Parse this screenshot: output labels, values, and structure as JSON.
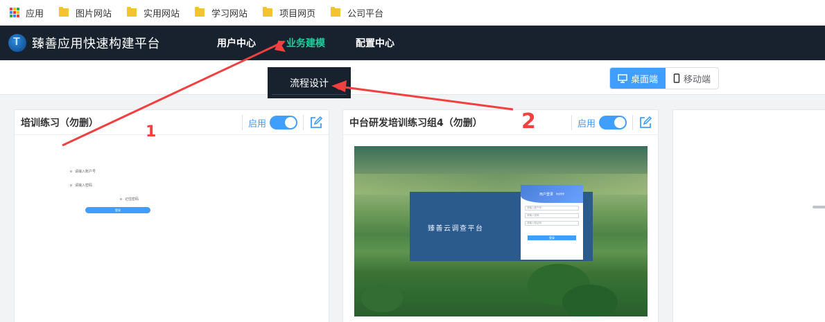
{
  "bookmarks": {
    "apps_label": "应用",
    "items": [
      "图片网站",
      "实用网站",
      "学习网站",
      "项目网页",
      "公司平台"
    ]
  },
  "nav": {
    "brand": "臻善应用快速构建平台",
    "items": [
      "用户中心",
      "业务建模",
      "配置中心"
    ],
    "active": "业务建模"
  },
  "dropdown": {
    "item": "流程设计"
  },
  "device_switch": {
    "desktop": "桌面端",
    "mobile": "移动端",
    "selected": "桌面端"
  },
  "cards": [
    {
      "title": "培训练习（勿删）",
      "enable_label": "启用",
      "enabled": true,
      "preview": {
        "field1": "请输入账户号",
        "field2": "请输入密码",
        "remember": "记住密码",
        "button": "登录"
      }
    },
    {
      "title": "中台研发培训练习组4（勿删）",
      "enable_label": "启用",
      "enabled": true,
      "preview": {
        "panel_title": "臻善云调查平台",
        "box_title": "用户登录",
        "box_note": "欢迎登录",
        "field1": "请输入账户号",
        "field2": "请输入密码",
        "field3": "请输入验证码",
        "button": "登录"
      }
    }
  ],
  "annotations": {
    "label1": "1",
    "label2": "2"
  },
  "colors": {
    "nav_bg": "#18222f",
    "active": "#27c79a",
    "primary": "#409eff",
    "annotation": "#f04040"
  }
}
